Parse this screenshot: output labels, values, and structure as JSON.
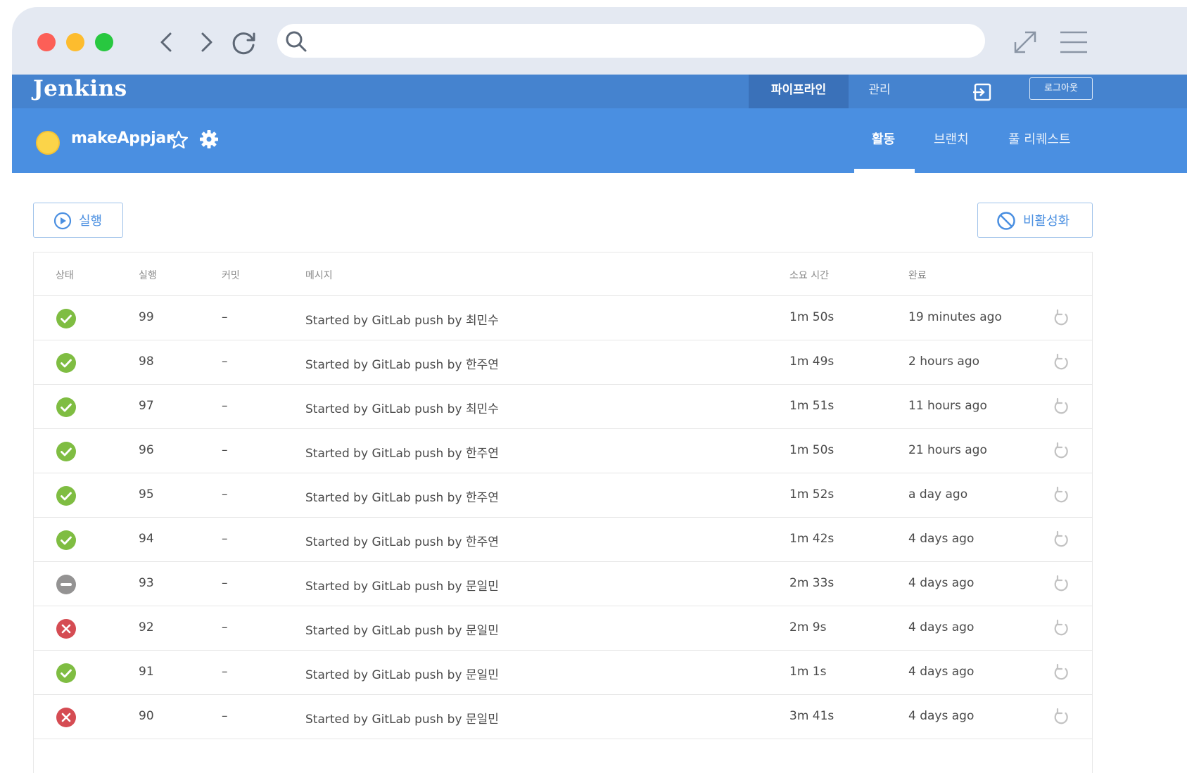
{
  "browser": {
    "url": ""
  },
  "jenkins": {
    "logo": "Jenkins",
    "nav": {
      "pipeline": "파이프라인",
      "manage": "관리",
      "logout": "로그아웃"
    }
  },
  "project": {
    "name": "makeAppjar",
    "tabs": {
      "activity": "활동",
      "branches": "브랜치",
      "pull_requests": "풀 리퀘스트"
    }
  },
  "actions": {
    "run": "실행",
    "disable": "비활성화"
  },
  "table": {
    "headers": {
      "status": "상태",
      "run": "실행",
      "commit": "커밋",
      "message": "메시지",
      "duration": "소요 시간",
      "completed": "완료"
    },
    "rows": [
      {
        "status": "success",
        "run": "99",
        "commit": "–",
        "message": "Started by GitLab push by 최민수",
        "duration": "1m 50s",
        "completed": "19 minutes ago"
      },
      {
        "status": "success",
        "run": "98",
        "commit": "–",
        "message": "Started by GitLab push by 한주연",
        "duration": "1m 49s",
        "completed": "2 hours ago"
      },
      {
        "status": "success",
        "run": "97",
        "commit": "–",
        "message": "Started by GitLab push by 최민수",
        "duration": "1m 51s",
        "completed": "11 hours ago"
      },
      {
        "status": "success",
        "run": "96",
        "commit": "–",
        "message": "Started by GitLab push by 한주연",
        "duration": "1m 50s",
        "completed": "21 hours ago"
      },
      {
        "status": "success",
        "run": "95",
        "commit": "–",
        "message": "Started by GitLab push by 한주연",
        "duration": "1m 52s",
        "completed": "a day ago"
      },
      {
        "status": "success",
        "run": "94",
        "commit": "–",
        "message": "Started by GitLab push by 한주연",
        "duration": "1m 42s",
        "completed": "4 days ago"
      },
      {
        "status": "aborted",
        "run": "93",
        "commit": "–",
        "message": "Started by GitLab push by 문일민",
        "duration": "2m 33s",
        "completed": "4 days ago"
      },
      {
        "status": "failed",
        "run": "92",
        "commit": "–",
        "message": "Started by GitLab push by 문일민",
        "duration": "2m 9s",
        "completed": "4 days ago"
      },
      {
        "status": "success",
        "run": "91",
        "commit": "–",
        "message": "Started by GitLab push by 문일민",
        "duration": "1m 1s",
        "completed": "4 days ago"
      },
      {
        "status": "failed",
        "run": "90",
        "commit": "–",
        "message": "Started by GitLab push by 문일민",
        "duration": "3m 41s",
        "completed": "4 days ago"
      }
    ]
  },
  "colors": {
    "topbar": "#4583cf",
    "projbar": "#4a8fe1",
    "success": "#7fbd42",
    "failed": "#d54c53",
    "aborted": "#949393"
  }
}
